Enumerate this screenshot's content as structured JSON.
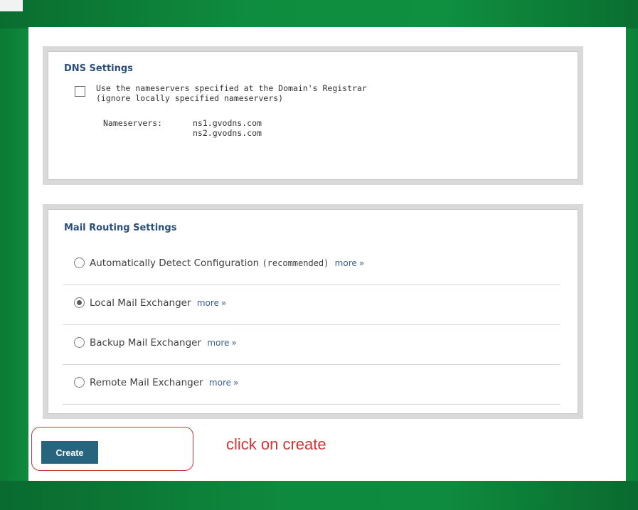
{
  "dns": {
    "title": "DNS Settings",
    "use_registrar_line1": "Use the nameservers specified at the Domain's Registrar",
    "use_registrar_line2": "(ignore locally specified nameservers)",
    "nameservers_label": "Nameservers:",
    "nameservers": [
      "ns1.gvodns.com",
      "ns2.gvodns.com"
    ]
  },
  "mail": {
    "title": "Mail Routing Settings",
    "more_text": "more",
    "options": [
      {
        "label": "Automatically Detect Configuration",
        "suffix": "(recommended)",
        "checked": false
      },
      {
        "label": "Local Mail Exchanger",
        "suffix": "",
        "checked": true
      },
      {
        "label": "Backup Mail Exchanger",
        "suffix": "",
        "checked": false
      },
      {
        "label": "Remote Mail Exchanger",
        "suffix": "",
        "checked": false
      }
    ]
  },
  "actions": {
    "create_label": "Create"
  },
  "annotation": {
    "text": "click on create"
  },
  "colors": {
    "background_green": "#1dc45e",
    "title_blue": "#2a4f7a",
    "button_blue": "#27657f",
    "annotation_red": "#d33535"
  }
}
